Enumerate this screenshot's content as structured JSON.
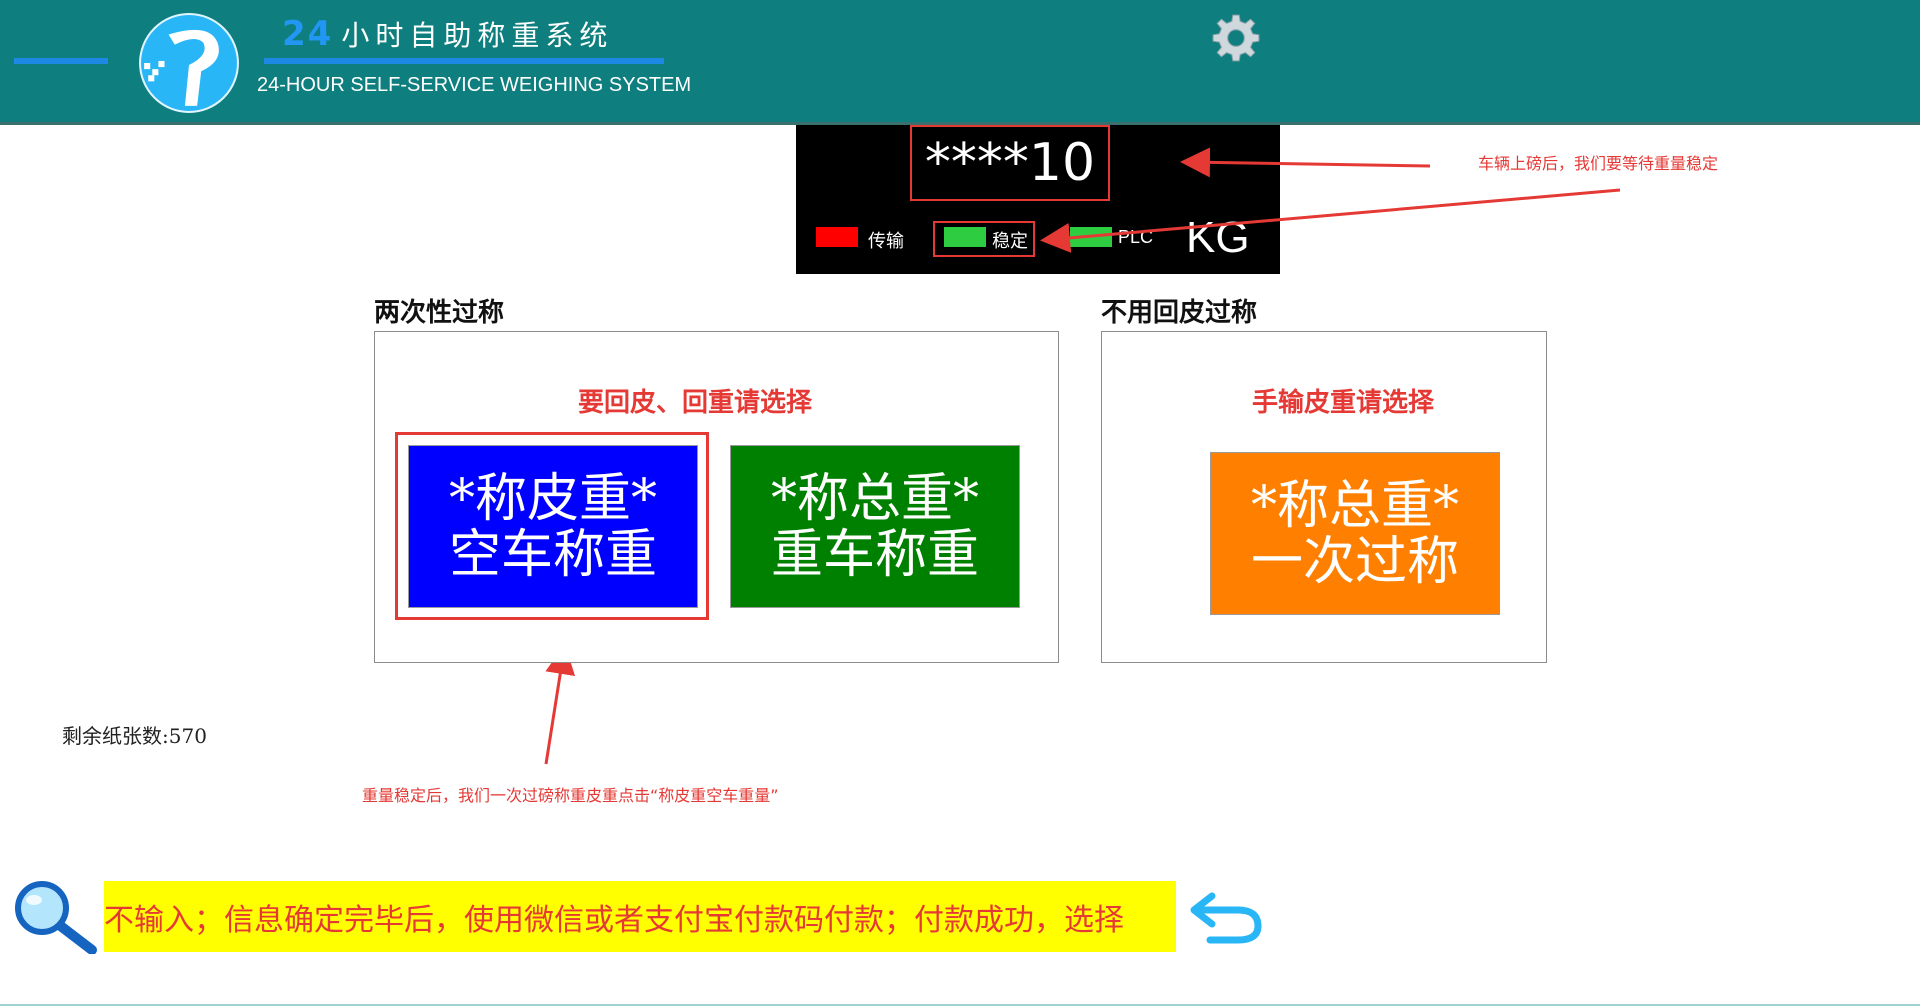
{
  "header": {
    "title_number": "24",
    "title_cn": "小时自助称重系统",
    "title_en": "24-HOUR SELF-SERVICE WEIGHING SYSTEM",
    "settings_icon": "gear-icon"
  },
  "display": {
    "weight": "****10",
    "unit": "KG",
    "indicators": [
      {
        "label": "传输",
        "color": "#ff0000"
      },
      {
        "label": "稳定",
        "color": "#2ecc40"
      },
      {
        "label": "PLC",
        "color": "#2ecc40"
      }
    ]
  },
  "annotations": {
    "top": "车辆上磅后，我们要等待重量稳定",
    "bottom": "重量稳定后，我们一次过磅称重皮重点击“称皮重空车重量”"
  },
  "two_pass": {
    "title": "两次性过称",
    "prompt": "要回皮、回重请选择",
    "tare_button": {
      "line1": "*称皮重*",
      "line2": "空车称重",
      "color": "#0000ff"
    },
    "gross_button": {
      "line1": "*称总重*",
      "line2": "重车称重",
      "color": "#008000"
    }
  },
  "single_pass": {
    "title": "不用回皮过称",
    "prompt": "手输皮重请选择",
    "button": {
      "line1": "*称总重*",
      "line2": "一次过称",
      "color": "#ff8000"
    }
  },
  "paper": {
    "label": "剩余纸张数:",
    "count": "570"
  },
  "marquee": {
    "text": "不输入；信息确定完毕后，使用微信或者支付宝付款码付款；付款成功，选择"
  },
  "icons": {
    "search": "search-icon",
    "back": "back-arrow-icon"
  }
}
